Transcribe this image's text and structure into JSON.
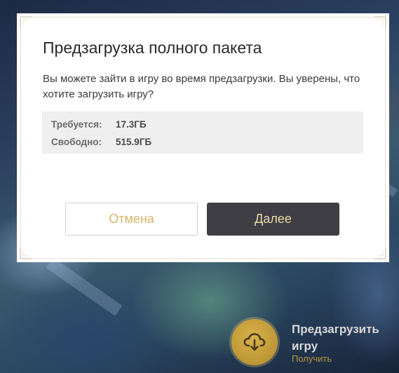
{
  "dialog": {
    "title": "Предзагрузка полного пакета",
    "message": "Вы можете зайти в игру во время предзагрузки. Вы уверены, что хотите загрузить игру?",
    "info": [
      {
        "label": "Требуется:",
        "value": "17.3ГБ"
      },
      {
        "label": "Свободно:",
        "value": "515.9ГБ"
      }
    ],
    "cancel_label": "Отмена",
    "next_label": "Далее"
  },
  "preload": {
    "icon": "cloud-download-icon",
    "title": "Предзагрузить игру",
    "subtitle": "Получить"
  },
  "colors": {
    "accent_gold": "#d7b46a",
    "button_dark": "#3e3e44",
    "info_bg": "#efefef"
  }
}
